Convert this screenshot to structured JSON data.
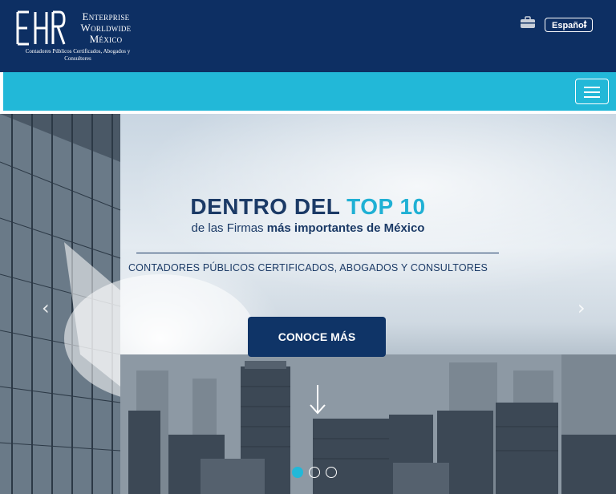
{
  "header": {
    "brand_line1": "Enterprise",
    "brand_line2": "Worldwide",
    "brand_line3": "México",
    "tagline": "Contadores Públicos Certificados, Abogados y Consultores",
    "icons": [
      "logo-ewm-icon",
      "briefcase-icon"
    ],
    "language_select": {
      "value": "Español"
    }
  },
  "navbar": {
    "menu_icon": "hamburger-menu-icon",
    "color": "#22b8d8"
  },
  "hero": {
    "headline_pre": "DENTRO DEL ",
    "headline_accent": "TOP 10",
    "subhead_pre": "de las Firmas ",
    "subhead_bold": "más importantes de México",
    "tagline": "CONTADORES PÚBLICOS CERTIFICADOS, ABOGADOS Y CONSULTORES",
    "cta_label": "CONOCE MÁS",
    "prev_glyph": "‹",
    "next_glyph": "›",
    "carousel": {
      "slides": 3,
      "active": 1
    }
  },
  "colors": {
    "header_bg": "#0d2f63",
    "accent": "#1fb0d4",
    "text_dark": "#1b3a66",
    "cta_bg": "#0f3467"
  }
}
